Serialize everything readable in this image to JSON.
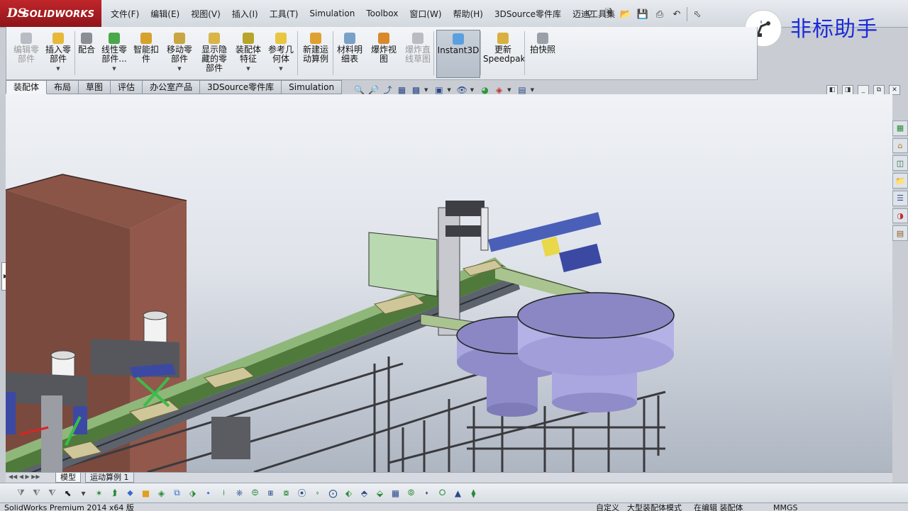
{
  "app": {
    "logo_mark": "DS",
    "logo_name": "SOLIDWORKS"
  },
  "menu": [
    "文件(F)",
    "编辑(E)",
    "视图(V)",
    "插入(I)",
    "工具(T)",
    "Simulation",
    "Toolbox",
    "窗口(W)",
    "帮助(H)",
    "3DSource零件库",
    "迈迪工具集"
  ],
  "watermark": {
    "text": "非标助手"
  },
  "ribbon": [
    {
      "label": "编辑零\n部件",
      "disabled": true,
      "icon": "edit-component-icon",
      "color": "#b9bcc2"
    },
    {
      "label": "插入零\n部件",
      "icon": "insert-component-icon",
      "color": "#e8b83a",
      "caret": true
    },
    {
      "label": "配合",
      "icon": "mate-icon",
      "color": "#8a8f96"
    },
    {
      "label": "线性零\n部件...",
      "icon": "linear-pattern-icon",
      "color": "#4aa84a",
      "caret": true
    },
    {
      "label": "智能扣\n件",
      "icon": "smart-fastener-icon",
      "color": "#d6a22c"
    },
    {
      "label": "移动零\n部件",
      "icon": "move-component-icon",
      "color": "#c9a640",
      "caret": true
    },
    {
      "label": "显示隐\n藏的零\n部件",
      "icon": "show-hidden-icon",
      "color": "#d9b548"
    },
    {
      "label": "装配体\n特征",
      "icon": "assembly-feature-icon",
      "color": "#b8a42a",
      "caret": true
    },
    {
      "label": "参考几\n何体",
      "icon": "reference-geometry-icon",
      "color": "#e8c640",
      "caret": true
    },
    {
      "label": "新建运\n动算例",
      "icon": "new-motion-study-icon",
      "color": "#e0a030"
    },
    {
      "label": "材料明\n细表",
      "icon": "bom-icon",
      "color": "#7aa0c8"
    },
    {
      "label": "爆炸视\n图",
      "icon": "exploded-view-icon",
      "color": "#d88a2a"
    },
    {
      "label": "爆炸直\n线草图",
      "disabled": true,
      "icon": "explode-line-sketch-icon",
      "color": "#b9bcc2"
    },
    {
      "label": "Instant3D",
      "icon": "instant3d-icon",
      "color": "#5aa0e0",
      "active": true
    },
    {
      "label": "更新\nSpeedpak",
      "icon": "speedpak-icon",
      "color": "#d8b040"
    },
    {
      "label": "拍快照",
      "icon": "snapshot-icon",
      "color": "#9aa0a8"
    }
  ],
  "command_tabs": [
    "装配体",
    "布局",
    "草图",
    "评估",
    "办公室产品",
    "3DSource零件库",
    "Simulation"
  ],
  "model_tabs": [
    "模型",
    "运动算例 1"
  ],
  "status": {
    "left": "SolidWorks Premium 2014 x64 版",
    "mid": "自定义",
    "doc": "大型装配体模式",
    "edit": "在编辑 装配体",
    "units": "MMGS"
  }
}
